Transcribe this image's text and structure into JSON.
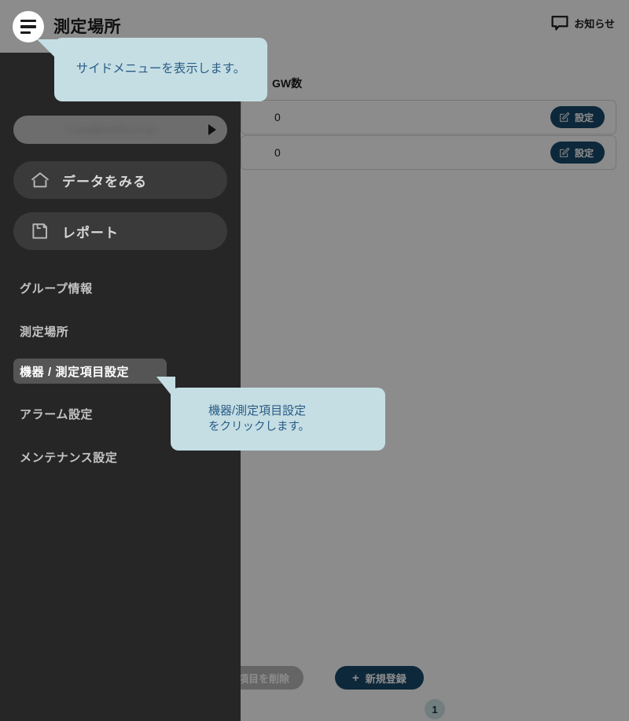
{
  "header": {
    "title": "測定場所",
    "menu_icon": "hamburger-icon",
    "notification": {
      "label": "お知らせ",
      "icon": "chat-bubble-icon"
    }
  },
  "table": {
    "column_header": "GW数",
    "rows": [
      {
        "gw_count": "0",
        "action_label": "設定",
        "action_icon": "pencil-edit-icon"
      },
      {
        "gw_count": "0",
        "action_label": "設定",
        "action_icon": "pencil-edit-icon"
      }
    ]
  },
  "bottom": {
    "delete_label": "択した項目を削除",
    "new_label": "新規登録",
    "new_icon": "plus-icon",
    "pagination": {
      "current": "1"
    }
  },
  "sidebar": {
    "account": {
      "value": "s-aaa@mailto.co.jp",
      "caret_icon": "play-triangle-icon"
    },
    "primary": [
      {
        "label": "データをみる",
        "icon": "home-icon"
      },
      {
        "label": "レポート",
        "icon": "report-icon"
      }
    ],
    "items": [
      {
        "label": "グループ情報",
        "selected": false
      },
      {
        "label": "測定場所",
        "selected": false
      },
      {
        "label": "機器 / 測定項目設定",
        "selected": true
      },
      {
        "label": "アラーム設定",
        "selected": false
      },
      {
        "label": "メンテナンス設定",
        "selected": false
      }
    ]
  },
  "tooltips": {
    "menu": {
      "text": "サイドメニューを表示します。"
    },
    "nav": {
      "line1": "機器/測定項目設定",
      "line2": "をクリックします。"
    }
  },
  "colors": {
    "accent_blue": "#194a6b",
    "tooltip_bg": "#c5dee4",
    "tooltip_text": "#2a5d85",
    "sidebar_bg": "#262626",
    "selected_item_bg": "#555555",
    "pager_bg": "#cfe3e6"
  }
}
